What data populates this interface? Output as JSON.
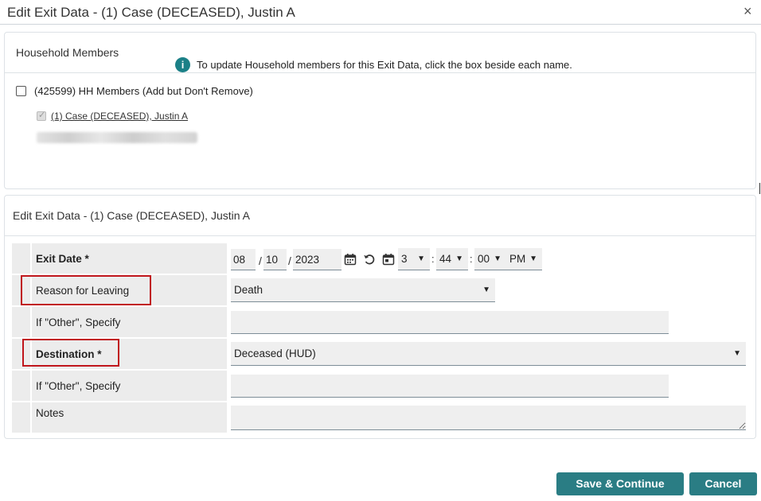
{
  "dialog": {
    "title": "Edit Exit Data - (1) Case (DECEASED), Justin A",
    "close_icon": "×"
  },
  "household": {
    "header": "Household Members",
    "info_text": "To update Household members for this Exit Data, click the box beside each name.",
    "info_icon": "i",
    "group_label": "(425599) HH Members (Add but Don't Remove)",
    "member_name": "(1) Case (DECEASED), Justin A"
  },
  "edit": {
    "header": "Edit Exit Data - (1) Case (DECEASED), Justin A",
    "exit_date_label": "Exit Date *",
    "exit_date": {
      "month": "08",
      "day": "10",
      "year": "2023",
      "hour": "3",
      "minute": "44",
      "second": "00",
      "ampm": "PM"
    },
    "slash": "/",
    "colon": ":",
    "reason_label": "Reason for Leaving",
    "reason_value": "Death",
    "other_label_1": "If \"Other\", Specify",
    "destination_label": "Destination *",
    "destination_value": "Deceased (HUD)",
    "other_label_2": "If \"Other\", Specify",
    "notes_label": "Notes"
  },
  "buttons": {
    "save": "Save & Continue",
    "cancel": "Cancel"
  },
  "colors": {
    "accent": "#2a7d84",
    "info_icon": "#1b8087",
    "highlight": "#c0161c"
  }
}
